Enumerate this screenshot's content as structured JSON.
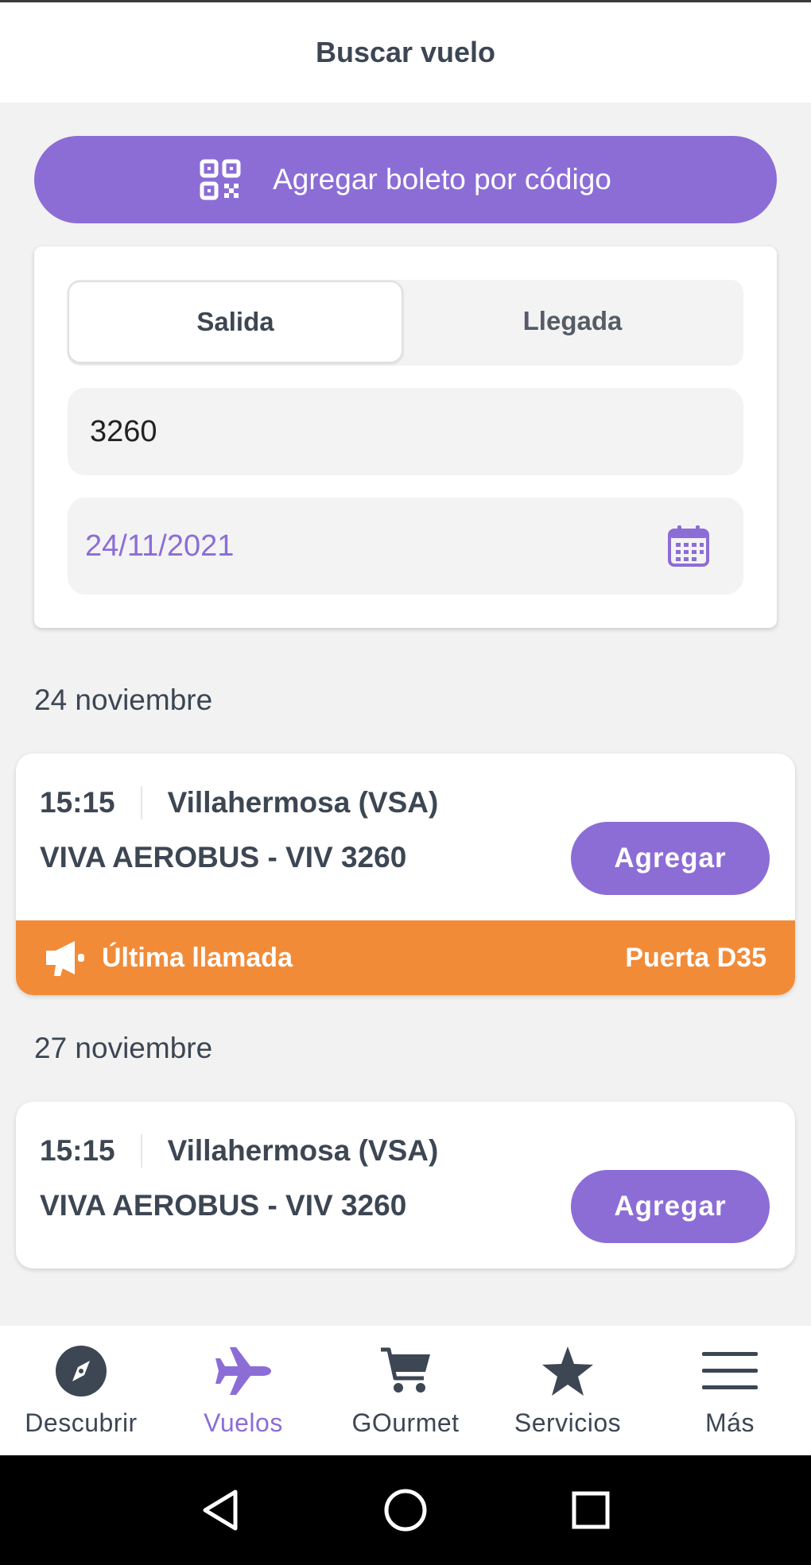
{
  "header": {
    "title": "Buscar vuelo"
  },
  "code_button": {
    "label": "Agregar boleto por código",
    "icon": "qr-code-icon"
  },
  "search": {
    "tabs": [
      {
        "label": "Salida",
        "active": true
      },
      {
        "label": "Llegada",
        "active": false
      }
    ],
    "flight_number": {
      "value": "3260"
    },
    "date": {
      "value": "24/11/2021",
      "icon": "calendar-icon"
    }
  },
  "results": [
    {
      "date_heading": "24 noviembre",
      "time": "15:15",
      "city": "Villahermosa (VSA)",
      "airline": "VIVA AEROBUS - VIV 3260",
      "add_label": "Agregar",
      "status": {
        "label": "Última llamada",
        "gate": "Puerta D35",
        "color": "#f28b38",
        "icon": "megaphone-icon"
      }
    },
    {
      "date_heading": "27 noviembre",
      "time": "15:15",
      "city": "Villahermosa (VSA)",
      "airline": "VIVA AEROBUS - VIV 3260",
      "add_label": "Agregar"
    }
  ],
  "nav": {
    "items": [
      {
        "label": "Descubrir",
        "icon": "compass-icon",
        "active": false
      },
      {
        "label": "Vuelos",
        "icon": "airplane-icon",
        "active": true
      },
      {
        "label": "GOurmet",
        "icon": "cart-icon",
        "active": false
      },
      {
        "label": "Servicios",
        "icon": "star-icon",
        "active": false
      },
      {
        "label": "Más",
        "icon": "menu-icon",
        "active": false
      }
    ]
  },
  "colors": {
    "accent": "#8c6dd6",
    "text": "#3d4653",
    "warning": "#f28b38"
  }
}
